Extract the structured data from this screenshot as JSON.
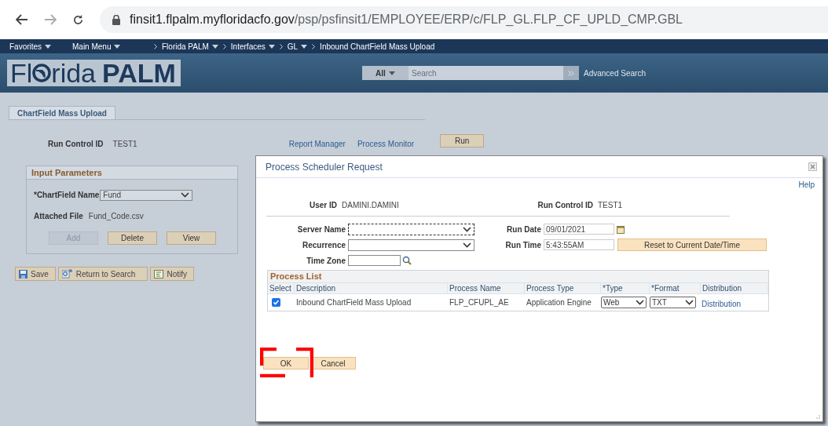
{
  "browser": {
    "host": "finsit1.flpalm.myfloridacfo.gov",
    "path": "/psp/psfinsit1/EMPLOYEE/ERP/c/FLP_GL.FLP_CF_UPLD_CMP.GBL"
  },
  "nav": {
    "menus": [
      "Favorites",
      "Main Menu"
    ],
    "breadcrumbs": [
      {
        "label": "Florida PALM",
        "dropdown": true
      },
      {
        "label": "Interfaces",
        "dropdown": true
      },
      {
        "label": "GL",
        "dropdown": true
      },
      {
        "label": "Inbound ChartField Mass Upload",
        "dropdown": false
      }
    ]
  },
  "header": {
    "logo": [
      "Fl",
      "rida",
      "PALM"
    ],
    "search_scope": "All",
    "search_placeholder": "Search",
    "advanced_search": "Advanced Search"
  },
  "page": {
    "tab": "ChartField Mass Upload",
    "run_control_label": "Run Control ID",
    "run_control_value": "TEST1",
    "links": [
      "Report Manager",
      "Process Monitor"
    ],
    "run_button": "Run",
    "group": {
      "title": "Input Parameters",
      "chartfield_label": "*ChartField Name",
      "chartfield_value": "Fund",
      "file_label": "Attached File",
      "file_value": "Fund_Code.csv",
      "buttons": [
        {
          "label": "Add",
          "disabled": true
        },
        {
          "label": "Delete",
          "disabled": false
        },
        {
          "label": "View",
          "disabled": false
        }
      ]
    },
    "toolbar": [
      {
        "label": "Save",
        "kind": "save"
      },
      {
        "label": "Return to Search",
        "kind": "return"
      },
      {
        "label": "Notify",
        "kind": "notify"
      }
    ]
  },
  "dialog": {
    "title": "Process Scheduler Request",
    "help": "Help",
    "user_id_label": "User ID",
    "user_id_value": "DAMINI.DAMINI",
    "run_control_label": "Run Control ID",
    "run_control_value": "TEST1",
    "server_name_label": "Server Name",
    "recurrence_label": "Recurrence",
    "time_zone_label": "Time Zone",
    "run_date_label": "Run Date",
    "run_date_value": "09/01/2021",
    "run_time_label": "Run Time",
    "run_time_value": "5:43:55AM",
    "reset_button": "Reset to Current Date/Time",
    "process_list": {
      "title": "Process List",
      "columns": [
        "Select",
        "Description",
        "Process Name",
        "Process Type",
        "*Type",
        "*Format",
        "Distribution"
      ],
      "rows": [
        {
          "checked": true,
          "description": "Inbound ChartField Mass Upload",
          "process_name": "FLP_CFUPL_AE",
          "process_type": "Application Engine",
          "type": "Web",
          "format": "TXT",
          "distribution": "Distribution"
        }
      ]
    },
    "buttons": [
      "OK",
      "Cancel"
    ]
  }
}
